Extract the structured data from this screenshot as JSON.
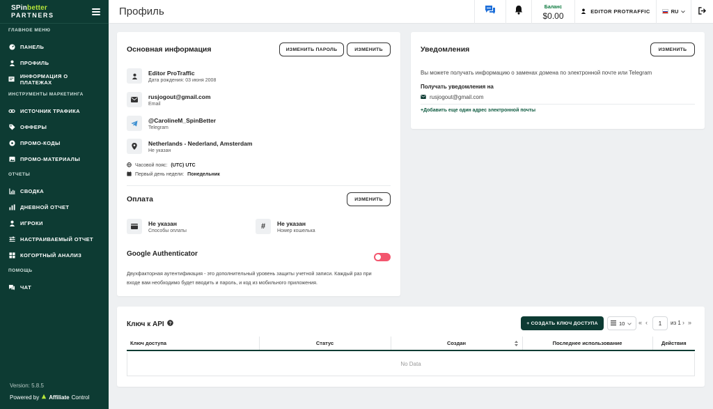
{
  "sidebar": {
    "logo_line1_a": "SPin",
    "logo_line1_b": "better",
    "logo_line2": "PARTNERS",
    "section_main": "ГЛАВНОЕ МЕНЮ",
    "main_items": [
      {
        "label": "ПАНЕЛЬ",
        "icon": "dashboard-icon"
      },
      {
        "label": "ПРОФИЛЬ",
        "icon": "user-icon"
      },
      {
        "label": "ИНФОРМАЦИЯ О ПЛАТЕЖАХ",
        "icon": "payments-icon"
      }
    ],
    "section_tools": "ИНСТРУМЕНТЫ МАРКЕТИНГА",
    "tools_items": [
      {
        "label": "ИСТОЧНИК ТРАФИКА",
        "icon": "link-icon"
      },
      {
        "label": "ОФФЕРЫ",
        "icon": "tag-icon"
      },
      {
        "label": "ПРОМО-КОДЫ",
        "icon": "promo-code-icon"
      },
      {
        "label": "ПРОМО-МАТЕРИАЛЫ",
        "icon": "image-icon"
      }
    ],
    "section_reports": "ОТЧЕТЫ",
    "reports_items": [
      {
        "label": "СВОДКА",
        "icon": "chart-icon"
      },
      {
        "label": "ДНЕВНОЙ ОТЧЕТ",
        "icon": "bar-chart-icon"
      },
      {
        "label": "ИГРОКИ",
        "icon": "player-icon"
      },
      {
        "label": "НАСТРАИВАЕМЫЙ ОТЧЕТ",
        "icon": "sliders-icon"
      },
      {
        "label": "КОГОРТНЫЙ АНАЛИЗ",
        "icon": "cohort-icon"
      }
    ],
    "section_help": "ПОМОЩЬ",
    "help_items": [
      {
        "label": "ЧАТ",
        "icon": "chat-icon"
      }
    ],
    "version": "Version: 5.8.5",
    "powered_by": "Powered by",
    "powered_brand_a": "Affiliate",
    "powered_brand_b": "Control"
  },
  "header": {
    "title": "Профиль",
    "balance_label": "Баланс",
    "balance_value": "$0.00",
    "user_name": "EDITOR PROTRAFFIC",
    "language": "RU"
  },
  "basic_info": {
    "title": "Основная информация",
    "change_password_button": "ИЗМЕНИТЬ ПАРОЛЬ",
    "edit_button": "ИЗМЕНИТЬ",
    "name": "Editor ProTraffic",
    "birth_date": "Дата рождения: 03 июня 2008",
    "email": "rusjogout@gmail.com",
    "email_label": "Email",
    "telegram": "@CarolineM_SpinBetter",
    "telegram_label": "Telegram",
    "location": "Netherlands - Nederland, Amsterdam",
    "location_label": "Не указан",
    "timezone_label": "Часовой пояс:",
    "timezone_value": "(UTC) UTC",
    "week_start_label": "Первый день недели:",
    "week_start_value": "Понедельник"
  },
  "payment": {
    "title": "Оплата",
    "edit_button": "ИЗМЕНИТЬ",
    "method_value": "Не указан",
    "method_label": "Способы оплаты",
    "wallet_value": "Не указан",
    "wallet_label": "Номер кошелька"
  },
  "google_auth": {
    "title": "Google Authenticator",
    "enabled": false,
    "description_line1": "Двухфакторная аутентификация - это дополнительный уровень защиты учетной записи. Каждый раз при",
    "description_line2": "входе вам необходимо будет вводить и пароль, и код из мобильного приложения."
  },
  "notifications": {
    "title": "Уведомления",
    "edit_button": "ИЗМЕНИТЬ",
    "description": "Вы можете получать информацию о заменах домена по электронной почте или Telegram",
    "receive_label": "Получать уведомления на",
    "email": "rusjogout@gmail.com",
    "add_email_link": "+Добавить еще один адрес электронной почты"
  },
  "api": {
    "title": "Ключ к API",
    "create_button": "+ СОЗДАТЬ КЛЮЧ ДОСТУПА",
    "page_size": "10",
    "current_page": "1",
    "of_total": "из 1",
    "columns": [
      "Ключ доступа",
      "Статус",
      "Создан",
      "Последнее использование",
      "Действия"
    ],
    "empty_text": "No Data"
  },
  "colors": {
    "sidebar_bg": "#0d3b33",
    "logo_accent": "#b6e63a",
    "toggle_off": "#f3566e",
    "chat_icon": "#1e6fd9"
  }
}
